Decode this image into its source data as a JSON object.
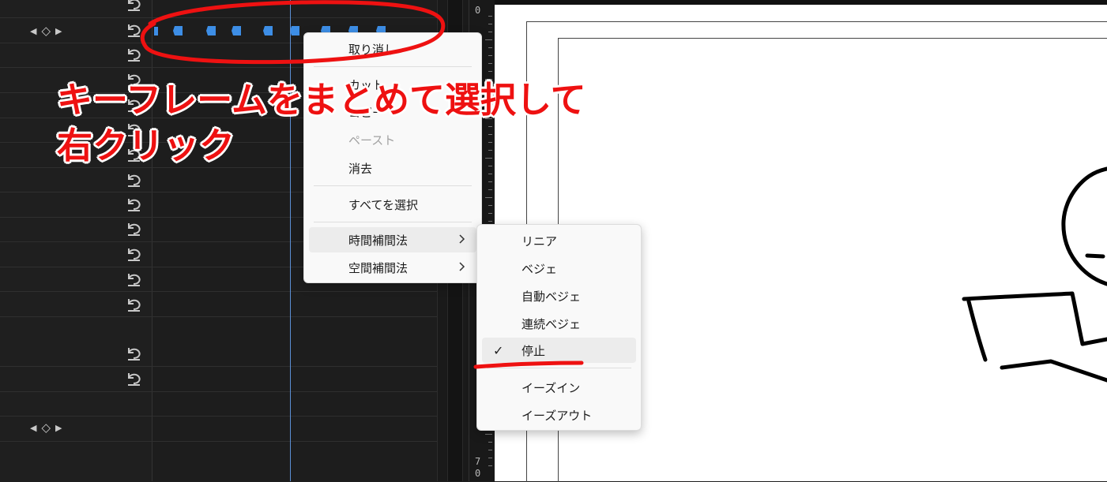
{
  "timeline": {
    "keyframe_nav_prev": "◀",
    "keyframe_nav_add": "◇",
    "keyframe_nav_next": "▶"
  },
  "ruler": {
    "top_label": "0",
    "bottom_label": "7",
    "bottom_label2": "0"
  },
  "context_menu": {
    "items": [
      {
        "label": "取り消し",
        "disabled": false
      },
      {
        "label": "カット",
        "disabled": false
      },
      {
        "label": "コピー",
        "disabled": false
      },
      {
        "label": "ペースト",
        "disabled": true
      },
      {
        "label": "消去",
        "disabled": false
      },
      {
        "label": "すべてを選択",
        "disabled": false
      },
      {
        "label": "時間補間法",
        "disabled": false,
        "submenu": true
      },
      {
        "label": "空間補間法",
        "disabled": false,
        "submenu": true
      }
    ]
  },
  "submenu": {
    "items": [
      {
        "label": "リニア"
      },
      {
        "label": "ベジェ"
      },
      {
        "label": "自動ベジェ"
      },
      {
        "label": "連続ベジェ"
      },
      {
        "label": "停止",
        "checked": true
      },
      {
        "label": "イーズイン"
      },
      {
        "label": "イーズアウト"
      }
    ],
    "check_mark": "✓"
  },
  "annotation": {
    "line1": "キーフレームをまとめて選択して",
    "line2": "右クリック"
  },
  "colors": {
    "keyframe": "#3d8ee6",
    "annotation_red": "#ee1111",
    "playhead": "#5b8fd6"
  }
}
